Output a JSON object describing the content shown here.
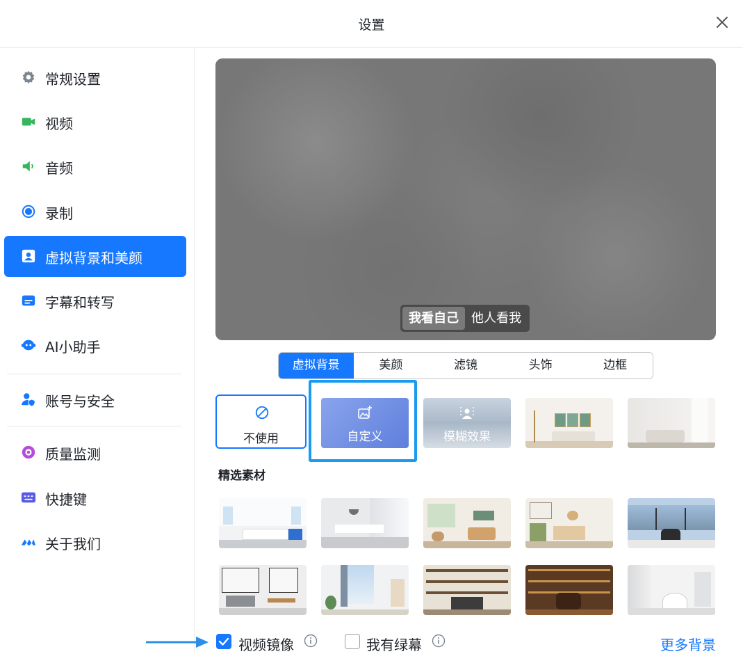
{
  "window": {
    "title": "设置"
  },
  "sidebar": {
    "items": [
      {
        "label": "常规设置",
        "icon": "gear-icon"
      },
      {
        "label": "视频",
        "icon": "video-camera-icon"
      },
      {
        "label": "音频",
        "icon": "speaker-icon"
      },
      {
        "label": "录制",
        "icon": "record-icon"
      },
      {
        "label": "虚拟背景和美颜",
        "icon": "portrait-icon",
        "active": true
      },
      {
        "label": "字幕和转写",
        "icon": "caption-icon"
      },
      {
        "label": "AI小助手",
        "icon": "robot-icon"
      },
      {
        "label": "账号与安全",
        "icon": "user-shield-icon"
      },
      {
        "label": "质量监测",
        "icon": "monitor-icon"
      },
      {
        "label": "快捷键",
        "icon": "keyboard-icon"
      },
      {
        "label": "关于我们",
        "icon": "logo-icon"
      }
    ]
  },
  "preview": {
    "view_options": [
      "我看自己",
      "他人看我"
    ],
    "selected_view": "我看自己"
  },
  "tabs": [
    "虚拟背景",
    "美颜",
    "滤镜",
    "头饰",
    "边框"
  ],
  "selected_tab": "虚拟背景",
  "backgrounds": {
    "none_label": "不使用",
    "custom_label": "自定义",
    "blur_label": "模糊效果"
  },
  "featured": {
    "title": "精选素材"
  },
  "bottom": {
    "mirror_label": "视频镜像",
    "mirror_checked": true,
    "greenscreen_label": "我有绿幕",
    "greenscreen_checked": false,
    "more_label": "更多背景"
  },
  "colors": {
    "accent": "#1677ff",
    "highlight_border": "#1a9bf0"
  }
}
